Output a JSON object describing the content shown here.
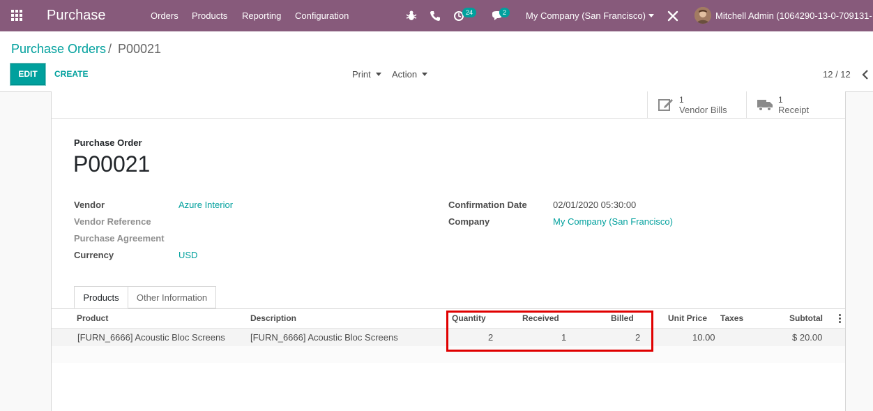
{
  "navbar": {
    "app_name": "Purchase",
    "menu": [
      "Orders",
      "Products",
      "Reporting",
      "Configuration"
    ],
    "activity_count": "24",
    "messages_count": "2",
    "company": "My Company (San Francisco)",
    "user": "Mitchell Admin (1064290-13-0-709131-",
    "icons": [
      "apps-grid-icon",
      "bug-icon",
      "phone-icon",
      "clock-icon",
      "chat-icon",
      "tools-icon",
      "avatar"
    ]
  },
  "breadcrumb": {
    "parent": "Purchase Orders",
    "separator": "/",
    "current": "P00021"
  },
  "actions": {
    "edit": "EDIT",
    "create": "CREATE",
    "print": "Print",
    "action": "Action"
  },
  "pager": {
    "value": "12 / 12"
  },
  "smart_buttons": [
    {
      "value": "1",
      "label": "Vendor Bills",
      "icon": "edit-pencil-icon"
    },
    {
      "value": "1",
      "label": "Receipt",
      "icon": "truck-icon"
    }
  ],
  "form": {
    "title_label": "Purchase Order",
    "title": "P00021",
    "left_fields": [
      {
        "label": "Vendor",
        "value": "Azure Interior"
      },
      {
        "label": "Vendor Reference",
        "value": ""
      },
      {
        "label": "Purchase Agreement",
        "value": ""
      },
      {
        "label": "Currency",
        "value": "USD"
      }
    ],
    "right_fields": [
      {
        "label": "Confirmation Date",
        "value": "02/01/2020 05:30:00"
      },
      {
        "label": "Company",
        "value": "My Company (San Francisco)"
      }
    ]
  },
  "tabs": [
    "Products",
    "Other Information"
  ],
  "table": {
    "columns": [
      "Product",
      "Description",
      "Quantity",
      "Received",
      "Billed",
      "Unit Price",
      "Taxes",
      "Subtotal"
    ],
    "rows": [
      {
        "product": "[FURN_6666] Acoustic Bloc Screens",
        "description": "[FURN_6666] Acoustic Bloc Screens",
        "quantity": "2",
        "received": "1",
        "billed": "2",
        "unit_price": "10.00",
        "taxes": "",
        "subtotal": "$ 20.00"
      }
    ]
  },
  "colors": {
    "navbar": "#875a7b",
    "accent": "#00a09d",
    "highlight": "#e00000"
  }
}
